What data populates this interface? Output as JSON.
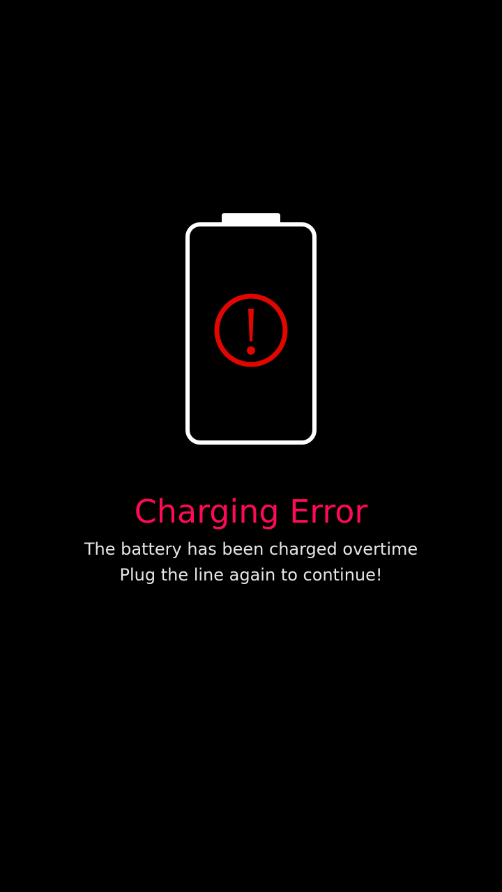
{
  "screen": {
    "title": "Charging Error",
    "message_line_1": "The battery has been charged overtime",
    "message_line_2": "Plug the line again to continue!"
  },
  "icons": {
    "battery": "battery-outline-icon",
    "warning": "exclamation-circle-icon"
  },
  "colors": {
    "background": "#000000",
    "title": "#ff0a54",
    "message": "#e6e6e6",
    "battery_outline": "#ffffff",
    "warning": "#e10600"
  }
}
